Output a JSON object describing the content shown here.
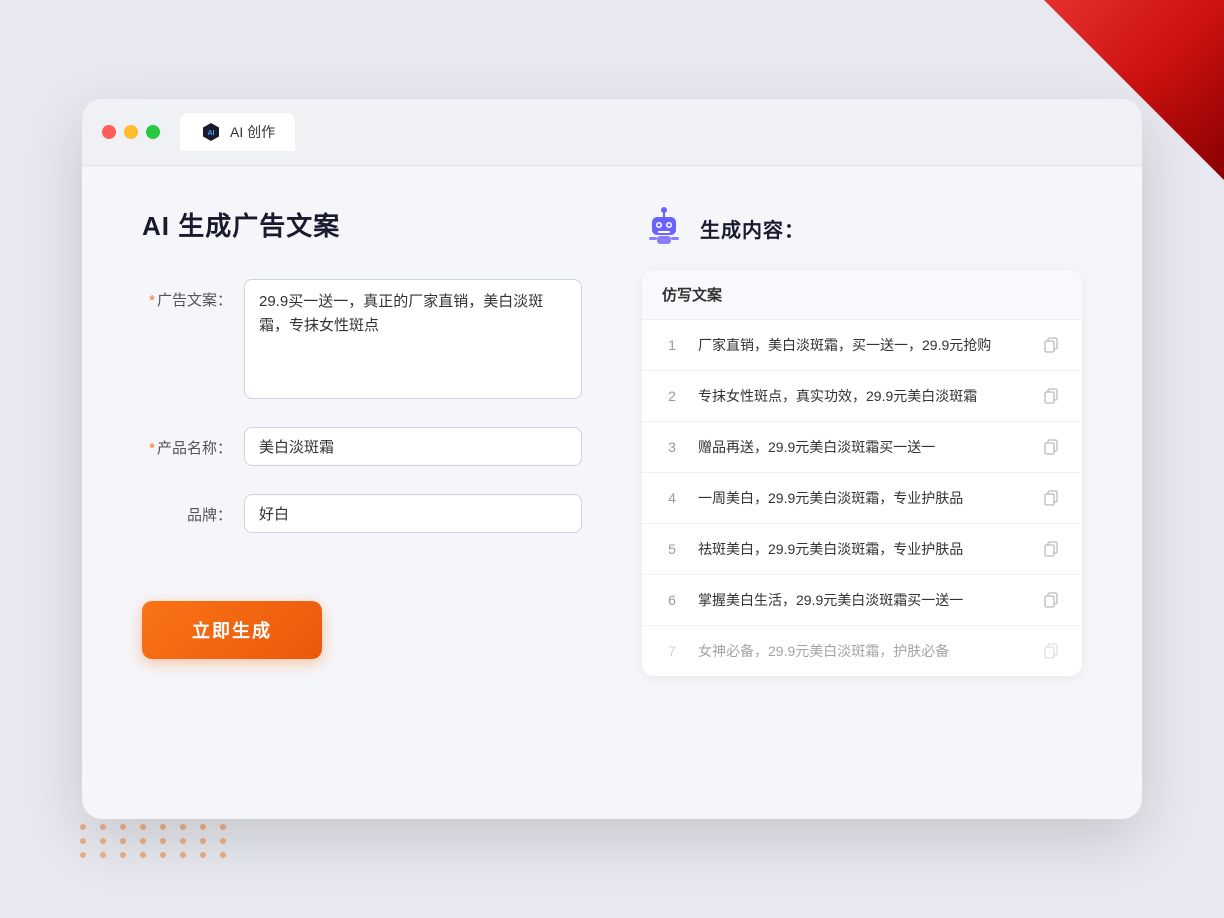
{
  "window": {
    "tab_label": "AI 创作"
  },
  "left_panel": {
    "title": "AI 生成广告文案",
    "fields": [
      {
        "label": "广告文案：",
        "required": true,
        "type": "textarea",
        "value": "29.9买一送一，真正的厂家直销，美白淡斑霜，专抹女性斑点",
        "name": "ad-copy-field"
      },
      {
        "label": "产品名称：",
        "required": true,
        "type": "input",
        "value": "美白淡斑霜",
        "name": "product-name-field"
      },
      {
        "label": "品牌：",
        "required": false,
        "type": "input",
        "value": "好白",
        "name": "brand-field"
      }
    ],
    "generate_button": "立即生成"
  },
  "right_panel": {
    "title": "生成内容：",
    "table_header": "仿写文案",
    "results": [
      {
        "num": "1",
        "text": "厂家直销，美白淡斑霜，买一送一，29.9元抢购",
        "faded": false
      },
      {
        "num": "2",
        "text": "专抹女性斑点，真实功效，29.9元美白淡斑霜",
        "faded": false
      },
      {
        "num": "3",
        "text": "赠品再送，29.9元美白淡斑霜买一送一",
        "faded": false
      },
      {
        "num": "4",
        "text": "一周美白，29.9元美白淡斑霜，专业护肤品",
        "faded": false
      },
      {
        "num": "5",
        "text": "祛斑美白，29.9元美白淡斑霜，专业护肤品",
        "faded": false
      },
      {
        "num": "6",
        "text": "掌握美白生活，29.9元美白淡斑霜买一送一",
        "faded": false
      },
      {
        "num": "7",
        "text": "女神必备，29.9元美白淡斑霜，护肤必备",
        "faded": true
      }
    ]
  },
  "colors": {
    "accent_orange": "#f97316",
    "brand_purple": "#6c63ff",
    "required_star": "#f97316"
  }
}
